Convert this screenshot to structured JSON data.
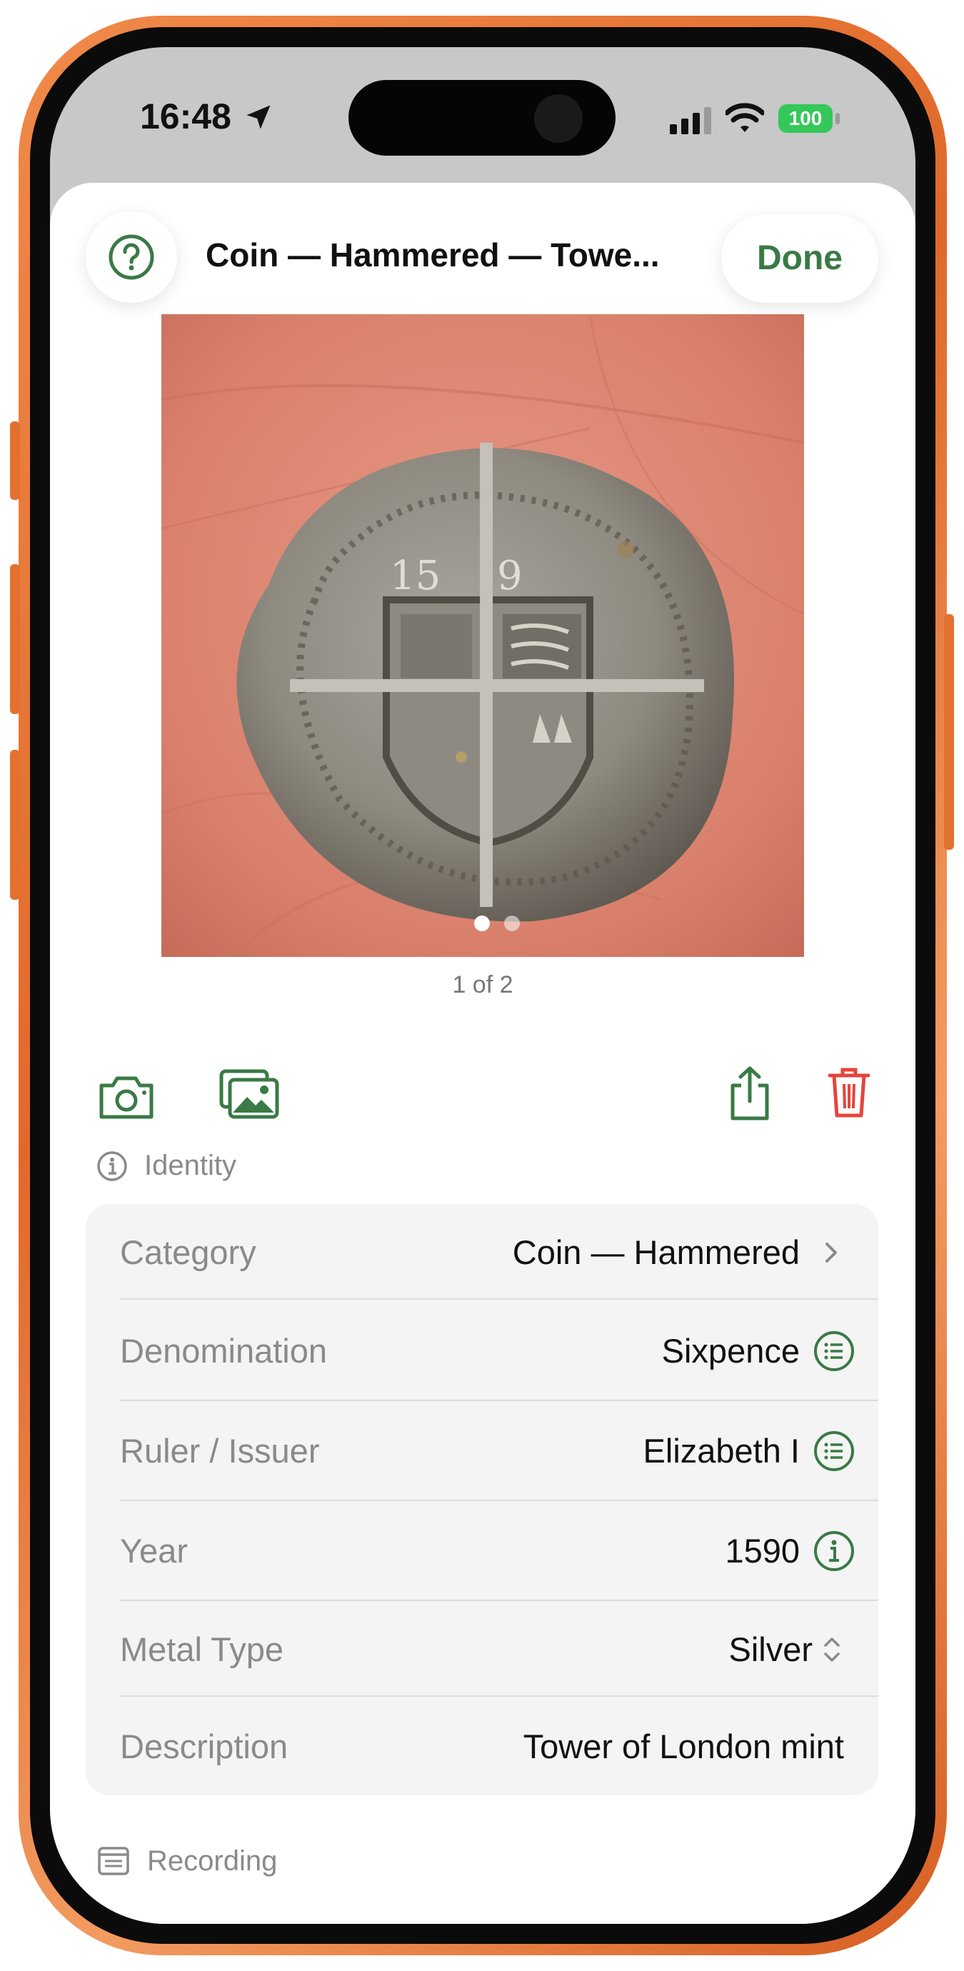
{
  "status": {
    "time": "16:48",
    "battery": "100"
  },
  "header": {
    "title": "Coin — Hammered — Towe...",
    "done_label": "Done"
  },
  "icons": {
    "help": "question-circle-icon",
    "camera": "camera-icon",
    "gallery": "photo-library-icon",
    "share": "share-icon",
    "trash": "trash-icon",
    "location": "location-arrow-icon"
  },
  "photo": {
    "page_label": "1 of 2",
    "page_count": 2,
    "current_page": 1
  },
  "sections": {
    "identity": "Identity",
    "recording": "Recording"
  },
  "identity_rows": [
    {
      "label": "Category",
      "value": "Coin — Hammered",
      "accessory": "chevron-right-icon"
    },
    {
      "label": "Denomination",
      "value": "Sixpence",
      "accessory": "list-circle-icon"
    },
    {
      "label": "Ruler / Issuer",
      "value": "Elizabeth I",
      "accessory": "list-circle-icon"
    },
    {
      "label": "Year",
      "value": "1590",
      "accessory": "info-circle-icon"
    },
    {
      "label": "Metal Type",
      "value": "Silver",
      "accessory": "updown-chevron-icon"
    },
    {
      "label": "Description",
      "value": "Tower of London mint",
      "accessory": ""
    }
  ],
  "colors": {
    "accent_green": "#3a7a45",
    "danger_red": "#e5453b",
    "frame_orange": "#e8763a",
    "battery_green": "#34c759"
  }
}
